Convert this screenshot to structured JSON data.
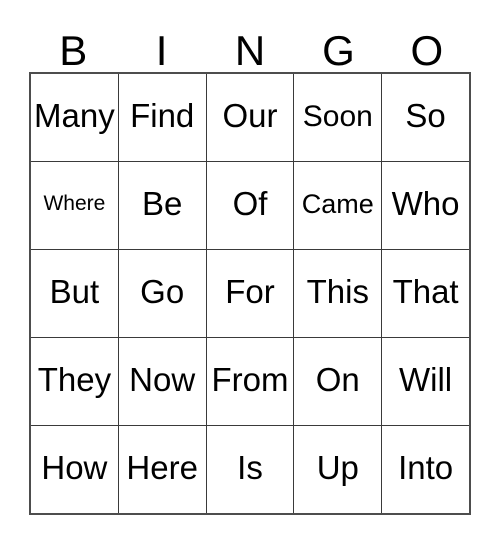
{
  "card": {
    "title": "BINGO Card",
    "background_color": "#ffffff",
    "text_color": "#000000",
    "border_color": "#3a3a3a",
    "outer_border_color": "#4d4d4d"
  },
  "header": {
    "letters": [
      "B",
      "I",
      "N",
      "G",
      "O"
    ]
  },
  "grid": {
    "rows": 5,
    "columns": 5,
    "cells": [
      [
        {
          "text": "Many",
          "size": "normal"
        },
        {
          "text": "Find",
          "size": "normal"
        },
        {
          "text": "Our",
          "size": "normal"
        },
        {
          "text": "Soon",
          "size": "md"
        },
        {
          "text": "So",
          "size": "normal"
        }
      ],
      [
        {
          "text": "Where",
          "size": "xs"
        },
        {
          "text": "Be",
          "size": "normal"
        },
        {
          "text": "Of",
          "size": "normal"
        },
        {
          "text": "Came",
          "size": "sm"
        },
        {
          "text": "Who",
          "size": "normal"
        }
      ],
      [
        {
          "text": "But",
          "size": "normal"
        },
        {
          "text": "Go",
          "size": "normal"
        },
        {
          "text": "For",
          "size": "normal"
        },
        {
          "text": "This",
          "size": "normal"
        },
        {
          "text": "That",
          "size": "normal"
        }
      ],
      [
        {
          "text": "They",
          "size": "normal"
        },
        {
          "text": "Now",
          "size": "normal"
        },
        {
          "text": "From",
          "size": "normal"
        },
        {
          "text": "On",
          "size": "normal"
        },
        {
          "text": "Will",
          "size": "normal"
        }
      ],
      [
        {
          "text": "How",
          "size": "normal"
        },
        {
          "text": "Here",
          "size": "normal"
        },
        {
          "text": "Is",
          "size": "normal"
        },
        {
          "text": "Up",
          "size": "normal"
        },
        {
          "text": "Into",
          "size": "normal"
        }
      ]
    ]
  }
}
